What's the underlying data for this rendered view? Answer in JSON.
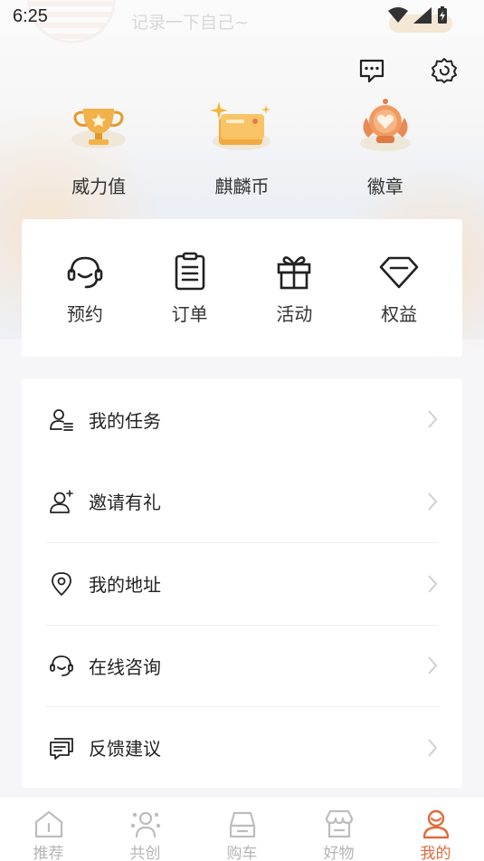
{
  "status": {
    "time": "6:25"
  },
  "profile": {
    "signature": "记录一下自己~"
  },
  "header": {
    "icons": [
      "message-icon",
      "settings-icon"
    ]
  },
  "stats": [
    {
      "label": "威力值",
      "icon": "trophy-icon"
    },
    {
      "label": "麒麟币",
      "icon": "coin-card-icon"
    },
    {
      "label": "徽章",
      "icon": "badge-icon"
    }
  ],
  "services": [
    {
      "label": "预约",
      "icon": "headset-icon"
    },
    {
      "label": "订单",
      "icon": "clipboard-icon"
    },
    {
      "label": "活动",
      "icon": "gift-icon"
    },
    {
      "label": "权益",
      "icon": "diamond-icon"
    }
  ],
  "menu": [
    {
      "label": "我的任务",
      "icon": "task-user-icon"
    },
    {
      "label": "邀请有礼",
      "icon": "add-user-icon"
    },
    {
      "label": "我的地址",
      "icon": "location-icon"
    },
    {
      "label": "在线咨询",
      "icon": "headset-icon"
    },
    {
      "label": "反馈建议",
      "icon": "feedback-icon"
    }
  ],
  "tabs": [
    {
      "label": "推荐",
      "icon": "home-icon",
      "active": false
    },
    {
      "label": "共创",
      "icon": "community-icon",
      "active": false
    },
    {
      "label": "购车",
      "icon": "car-icon",
      "active": false
    },
    {
      "label": "好物",
      "icon": "store-icon",
      "active": false
    },
    {
      "label": "我的",
      "icon": "profile-icon",
      "active": true
    }
  ],
  "colors": {
    "accent": "#e26a3b",
    "gold": "#f2b24a"
  }
}
